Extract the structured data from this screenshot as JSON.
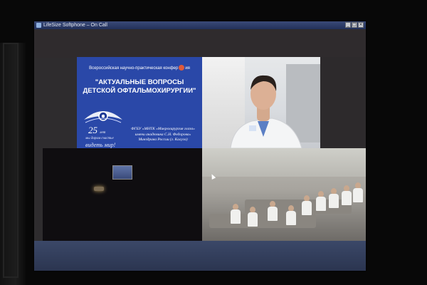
{
  "window": {
    "title": "LifeSize Softphone – On Call"
  },
  "slide": {
    "header_text": "Всероссийская научно-практическая конфер",
    "header_suffix": "ия",
    "title": "\"АКТУАЛЬНЫЕ ВОПРОСЫ ДЕТСКОЙ ОФТАЛЬМОХИРУРГИИ\"",
    "anniversary_number": "25",
    "anniversary_word": "лет",
    "slogan_line1": "мы дарим счастье",
    "slogan_line2": "видеть мир!",
    "org_line1": "ФГБУ «МНТК «Микрохирургия глаза»",
    "org_line2": "имени академика С.Н. Федорова»",
    "org_line3": "Минздрава России (г. Калуга)"
  },
  "icons": {
    "app": "lifesize-app-icon",
    "cursor": "mouse-cursor-icon"
  },
  "colors": {
    "slide_background": "#2a48a8",
    "titlebar": "#22305a",
    "screen_background": "#2e2c2e"
  }
}
